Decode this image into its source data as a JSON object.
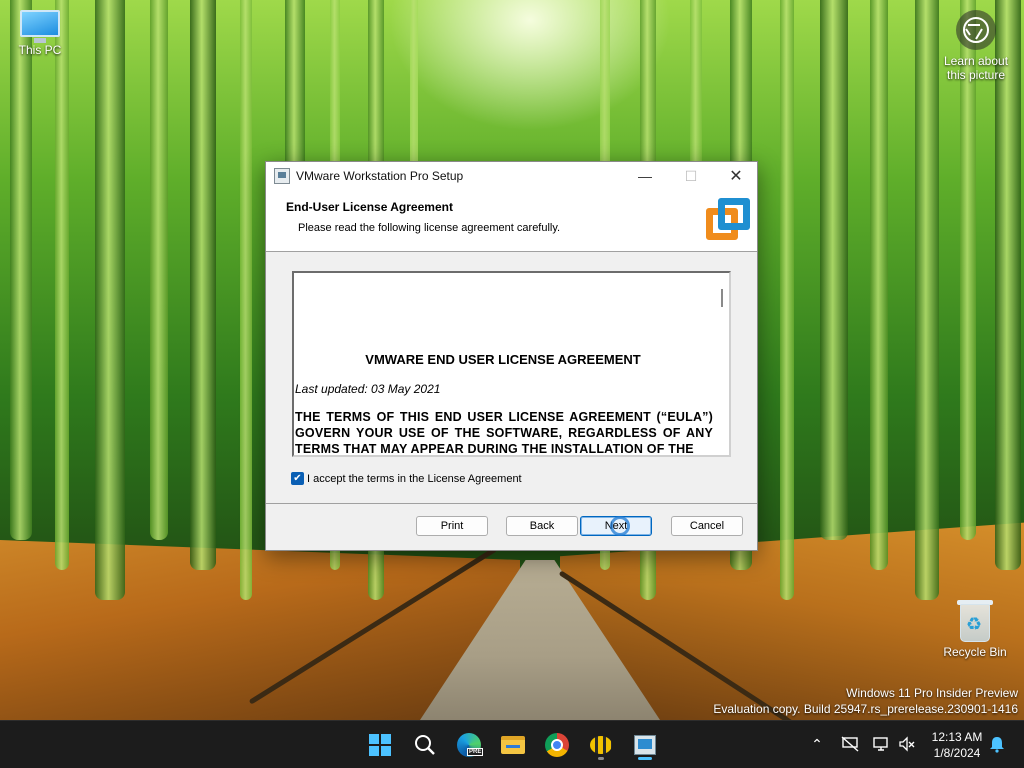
{
  "desktop": {
    "icons": {
      "this_pc": "This PC",
      "recycle_bin": "Recycle Bin"
    },
    "learn_about": "Learn about this picture",
    "watermark": {
      "line1": "Windows 11 Pro Insider Preview",
      "line2": "Evaluation copy. Build 25947.rs_prerelease.230901-1416"
    }
  },
  "dialog": {
    "title": "VMware Workstation Pro Setup",
    "header_title": "End-User License Agreement",
    "header_subtitle": "Please read the following license agreement carefully.",
    "eula": {
      "title": "VMWARE END USER LICENSE AGREEMENT",
      "updated": "Last updated: 03 May 2021",
      "terms": "THE TERMS OF THIS END USER LICENSE AGREEMENT (“EULA”) GOVERN YOUR USE OF THE SOFTWARE, REGARDLESS OF ANY TERMS THAT MAY APPEAR DURING THE INSTALLATION OF THE"
    },
    "accept_label": "I accept the terms in the License Agreement",
    "accept_checked": true,
    "buttons": {
      "print": "Print",
      "back": "Back",
      "next": "Next",
      "cancel": "Cancel"
    }
  },
  "taskbar": {
    "apps": [
      "start-icon",
      "search-icon",
      "edge-preview-icon",
      "file-explorer-icon",
      "chrome-icon",
      "bee-app-icon",
      "vmware-setup-icon"
    ],
    "tray": [
      "chevron-up-icon",
      "network-disconnected-icon",
      "display-icon",
      "speaker-muted-icon"
    ],
    "time": "12:13 AM",
    "date": "1/8/2024"
  },
  "colors": {
    "accent": "#0067c0",
    "vmware_orange": "#f08c1c",
    "vmware_blue": "#1f8fd1",
    "taskbar": "#1c1c1c"
  }
}
